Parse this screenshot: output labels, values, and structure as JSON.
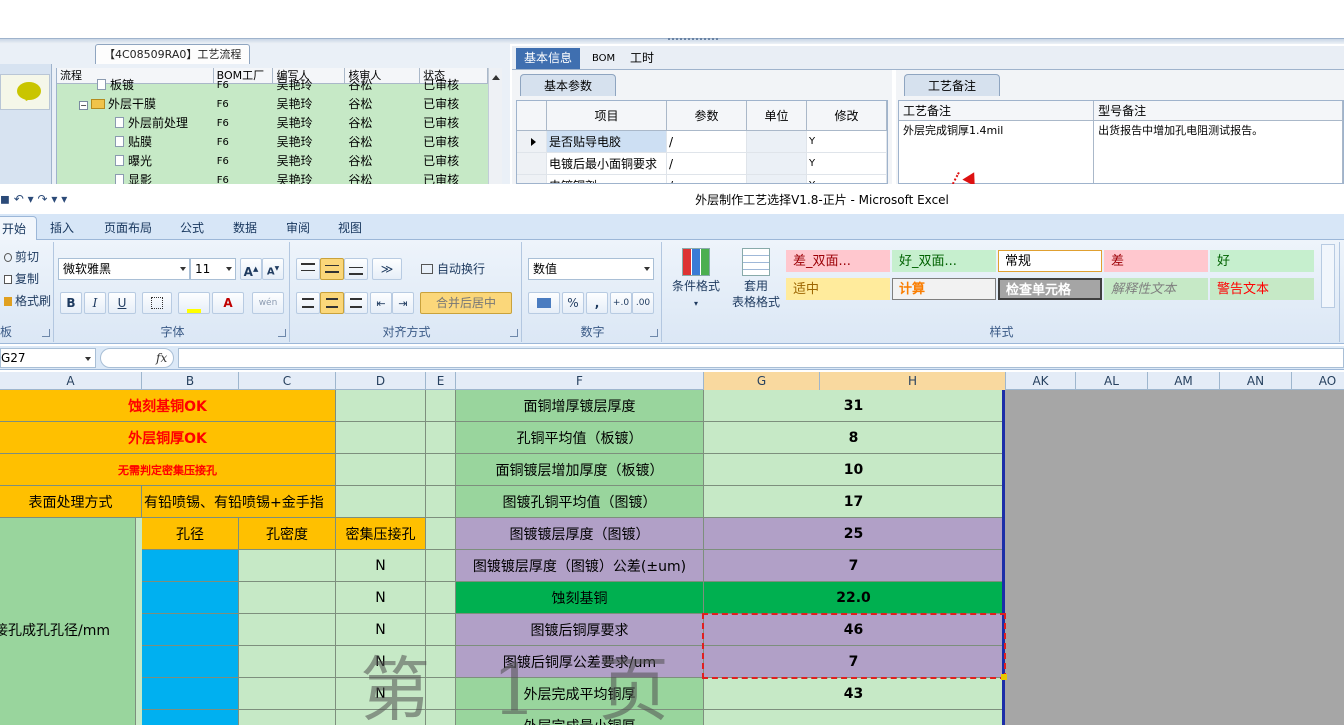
{
  "process_panel": {
    "title": "【4C08509RA0】工艺流程",
    "columns": [
      "流程",
      "BOM工厂",
      "编写人",
      "核审人",
      "状态"
    ],
    "rows": [
      {
        "flow": "板镀",
        "bom": "F6",
        "writer": "吴艳玲",
        "reviewer": "谷松",
        "status": "已审核",
        "level": "child"
      },
      {
        "flow": "外层干膜",
        "bom": "F6",
        "writer": "吴艳玲",
        "reviewer": "谷松",
        "status": "已审核",
        "level": "folder"
      },
      {
        "flow": "外层前处理",
        "bom": "F6",
        "writer": "吴艳玲",
        "reviewer": "谷松",
        "status": "已审核",
        "level": "child"
      },
      {
        "flow": "贴膜",
        "bom": "F6",
        "writer": "吴艳玲",
        "reviewer": "谷松",
        "status": "已审核",
        "level": "child"
      },
      {
        "flow": "曝光",
        "bom": "F6",
        "writer": "吴艳玲",
        "reviewer": "谷松",
        "status": "已审核",
        "level": "child"
      },
      {
        "flow": "显影",
        "bom": "F6",
        "writer": "吴艳玲",
        "reviewer": "谷松",
        "status": "已审核",
        "level": "child"
      }
    ]
  },
  "info_tabs": [
    "基本信息",
    "BOM",
    "工时"
  ],
  "basic_panel": {
    "subtab": "基本参数",
    "columns": [
      "项目",
      "参数",
      "单位",
      "修改"
    ],
    "rows": [
      {
        "item": "是否贴导电胶",
        "param": "/",
        "unit": "",
        "mod": "Y"
      },
      {
        "item": "电镀后最小面铜要求",
        "param": "/",
        "unit": "",
        "mod": "Y"
      },
      {
        "item": "电镀铜剂",
        "param": "/",
        "unit": "",
        "mod": "Y"
      }
    ]
  },
  "note_panel": {
    "subtab": "工艺备注",
    "columns": [
      "工艺备注",
      "型号备注"
    ],
    "process_note": "外层完成铜厚1.4mil",
    "type_note": "出货报告中增加孔电阻测试报告。"
  },
  "excel": {
    "title": "外层制作工艺选择V1.8-正片 - Microsoft Excel",
    "qat": "◼ ↶ ▾ ↷ ▾ ▾",
    "tabs": [
      "开始",
      "插入",
      "页面布局",
      "公式",
      "数据",
      "审阅",
      "视图"
    ],
    "clipboard": {
      "cut": "剪切",
      "copy": "复制",
      "format_painter": "格式刷",
      "label": "板"
    },
    "font": {
      "name": "微软雅黑",
      "size": "11",
      "grow": "A",
      "shrink": "A",
      "bold": "B",
      "italic": "I",
      "underline": "U",
      "color_a": "A",
      "wen": "wén",
      "label": "字体"
    },
    "align": {
      "wrap": "自动换行",
      "merge": "合并后居中",
      "label": "对齐方式"
    },
    "number": {
      "format": "数值",
      "percent": "%",
      "comma": ",",
      "inc": "+.0",
      "dec": ".00",
      "label": "数字"
    },
    "styles": {
      "cond_format": "条件格式",
      "table_format": [
        "套用",
        "表格格式"
      ],
      "label": "样式",
      "cells": [
        {
          "text": "差_双面...",
          "bg": "#ffc7ce",
          "color": "#9c0006"
        },
        {
          "text": "好_双面...",
          "bg": "#c6efce",
          "color": "#006100"
        },
        {
          "text": "常规",
          "bg": "#ffffff",
          "color": "#000000"
        },
        {
          "text": "差",
          "bg": "#ffc7ce",
          "color": "#9c0006"
        },
        {
          "text": "好",
          "bg": "#c6efce",
          "color": "#006100"
        },
        {
          "text": "适中",
          "bg": "#ffeb9c",
          "color": "#9c6500"
        },
        {
          "text": "计算",
          "bg": "#f2f2f2",
          "color": "#fa7d00"
        },
        {
          "text": "检查单元格",
          "bg": "#a5a5a5",
          "color": "#ffffff"
        },
        {
          "text": "解释性文本",
          "bg": "#c6e9c6",
          "color": "#7f7f7f"
        },
        {
          "text": "警告文本",
          "bg": "#c6e9c6",
          "color": "#ff0000"
        }
      ]
    },
    "name_box": "G27",
    "fx": "fx",
    "columns": [
      "A",
      "B",
      "C",
      "D",
      "E",
      "F",
      "G",
      "H",
      "AK",
      "AL",
      "AM",
      "AN",
      "AO"
    ],
    "left_block": {
      "r1": "蚀刻基铜OK",
      "r2": "外层铜厚OK",
      "r3": "无需判定密集压接孔",
      "r4_label": "表面处理方式",
      "r4_value": "有铅喷锡、有铅喷锡+金手指",
      "r5_b": "孔径",
      "r5_c": "孔密度",
      "r5_d": "密集压接孔",
      "side_label": "接孔成孔孔径/mm",
      "d_values": [
        "N",
        "N",
        "N",
        "N",
        "N"
      ]
    },
    "params": [
      {
        "label": "面铜增厚镀层厚度",
        "value": "31",
        "style": "ltgreen"
      },
      {
        "label": "孔铜平均值（板镀）",
        "value": "8",
        "style": "ltgreen"
      },
      {
        "label": "面铜镀层增加厚度（板镀）",
        "value": "10",
        "style": "ltgreen"
      },
      {
        "label": "图镀孔铜平均值（图镀）",
        "value": "17",
        "style": "ltgreen"
      },
      {
        "label": "图镀镀层厚度（图镀）",
        "value": "25",
        "style": "purple"
      },
      {
        "label": "图镀镀层厚度（图镀）公差(±um)",
        "value": "7",
        "style": "purple"
      },
      {
        "label": "蚀刻基铜",
        "value": "22.0",
        "style": "dkgreen"
      },
      {
        "label": "图镀后铜厚要求",
        "value": "46",
        "style": "purple"
      },
      {
        "label": "图镀后铜厚公差要求/um",
        "value": "7",
        "style": "purple"
      },
      {
        "label": "外层完成平均铜厚",
        "value": "43",
        "style": "ltgreen"
      },
      {
        "label": "外层完成最小铜厚",
        "value": "",
        "style": "ltgreen"
      }
    ],
    "watermark": "第 1 页"
  }
}
